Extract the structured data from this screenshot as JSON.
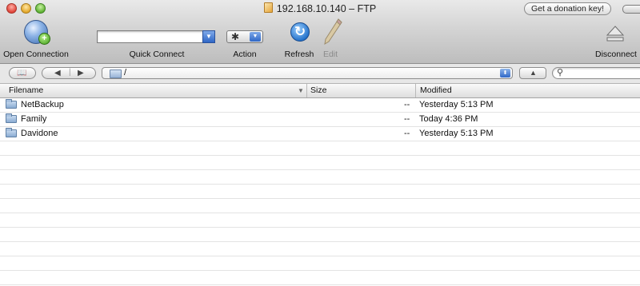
{
  "window": {
    "title": "192.168.10.140 – FTP",
    "donation_label": "Get a donation key!"
  },
  "toolbar": {
    "open_connection": "Open Connection",
    "quick_connect": "Quick Connect",
    "action": "Action",
    "refresh": "Refresh",
    "edit": "Edit",
    "disconnect": "Disconnect",
    "quick_connect_value": ""
  },
  "pathbar": {
    "path": "/",
    "search_value": ""
  },
  "table": {
    "columns": {
      "filename": "Filename",
      "size": "Size",
      "modified": "Modified"
    },
    "rows": [
      {
        "name": "NetBackup",
        "size": "--",
        "modified": "Yesterday 5:13 PM"
      },
      {
        "name": "Family",
        "size": "--",
        "modified": "Today 4:36 PM"
      },
      {
        "name": "Davidone",
        "size": "--",
        "modified": "Yesterday 5:13 PM"
      }
    ]
  }
}
